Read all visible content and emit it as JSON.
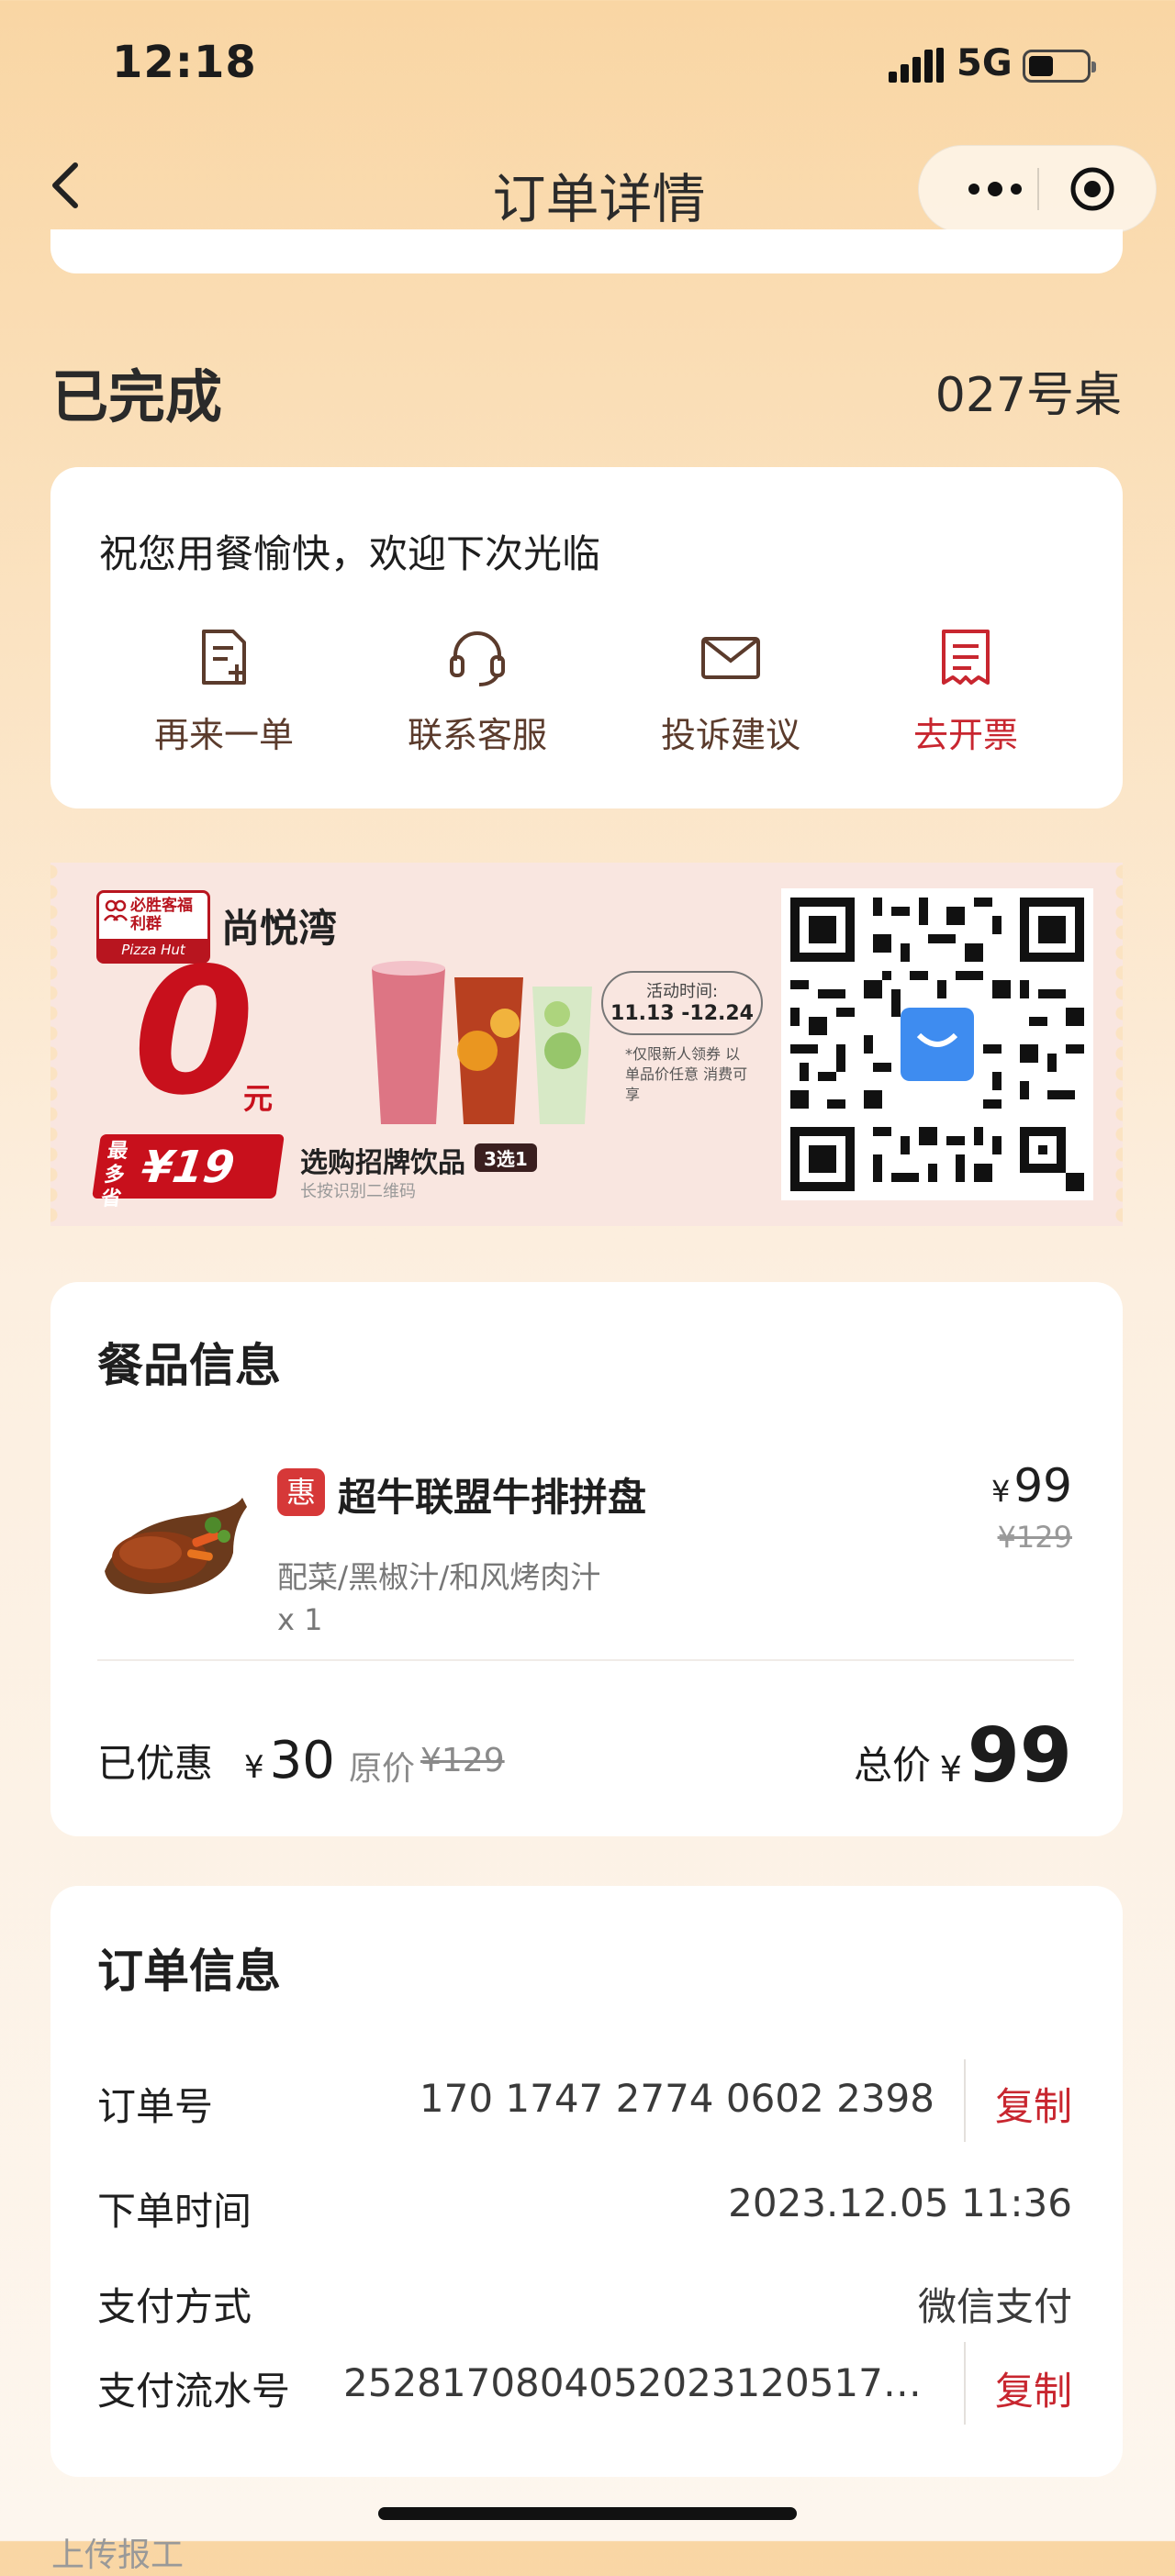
{
  "status_bar": {
    "time": "12:18",
    "network": "5G"
  },
  "nav": {
    "title": "订单详情"
  },
  "order_status": {
    "status": "已完成",
    "table": "027号桌"
  },
  "welcome": {
    "message": "祝您用餐愉快，欢迎下次光临",
    "actions": [
      {
        "label": "再来一单",
        "icon": "reorder-icon"
      },
      {
        "label": "联系客服",
        "icon": "headset-icon"
      },
      {
        "label": "投诉建议",
        "icon": "mail-icon"
      },
      {
        "label": "去开票",
        "icon": "invoice-icon"
      }
    ]
  },
  "ad": {
    "brand": "必胜客福利群",
    "brand_sub": "Pizza Hut",
    "store": "尚悦湾",
    "big_number": "0",
    "unit": "元",
    "save_prefix": "最多省",
    "save_amount": "¥19",
    "promo": "选购招牌饮品",
    "promo_tag": "3选1",
    "hint": "长按识别二维码",
    "time_label": "活动时间:",
    "time_range": "11.13 -12.24",
    "note": "*仅限新人领券 以单品价任意 消费可享"
  },
  "food": {
    "title": "餐品信息",
    "item": {
      "badge": "惠",
      "name": "超牛联盟牛排拼盘",
      "options": "配菜/黑椒汁/和风烤肉汁",
      "qty": "x 1",
      "currency": "¥",
      "price": "99",
      "original_price": "¥129"
    },
    "saved_label": "已优惠",
    "saved_currency": "¥",
    "saved_amount": "30",
    "orig_label": "原价",
    "orig_value": "¥129",
    "total_label": "总价",
    "total_currency": "¥",
    "total_amount": "99"
  },
  "order_info": {
    "title": "订单信息",
    "order_no_label": "订单号",
    "order_no": "170 1747 2774 0602 2398",
    "copy_label": "复制",
    "time_label": "下单时间",
    "time": "2023.12.05 11:36",
    "pay_method_label": "支付方式",
    "pay_method": "微信支付",
    "pay_serial_label": "支付流水号",
    "pay_serial": "25281708040520231205170..."
  },
  "peek_text": "上传报工",
  "colors": {
    "accent": "#c8262f",
    "background": "#f9d6a4"
  }
}
